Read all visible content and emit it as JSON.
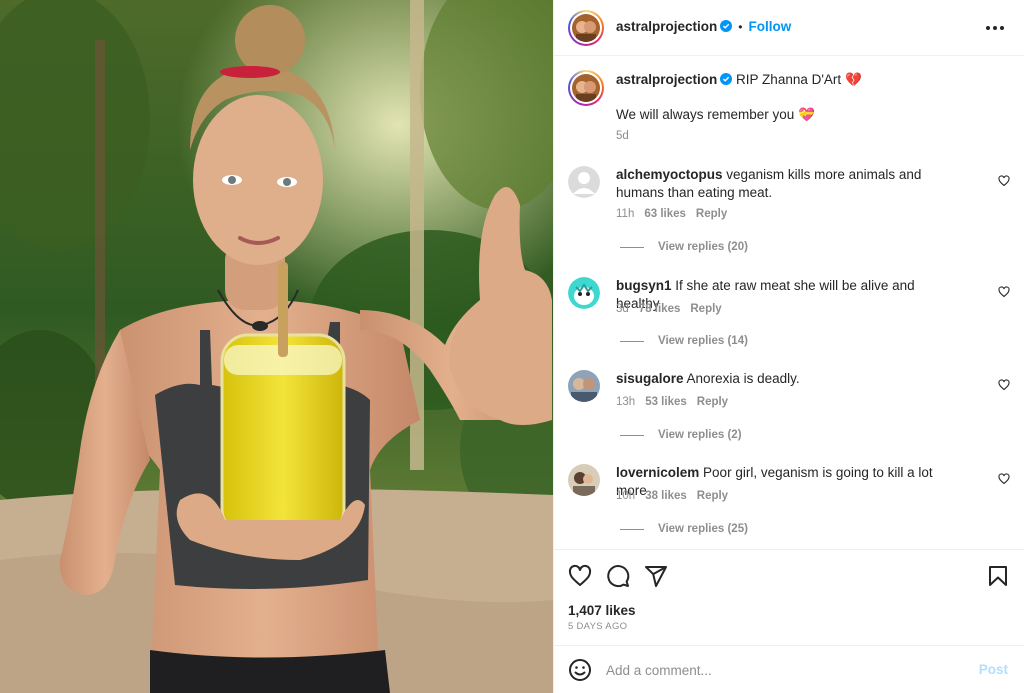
{
  "post": {
    "author": "astralprojection",
    "follow_label": "Follow",
    "header_separator": "•",
    "caption": {
      "line1": "RIP Zhanna D'Art",
      "line1_emoji": "💔",
      "line2": "We will always remember you",
      "line2_emoji": "💝",
      "time": "5d"
    },
    "photo_alt": "Woman holding a glass of yellow juice with a straw, giving a thumbs up in a jungle",
    "likes": "1,407 likes",
    "date": "5 DAYS AGO"
  },
  "comments": [
    {
      "user": "alchemyoctopus",
      "text": "veganism kills more animals and humans than eating meat.",
      "time": "11h",
      "likes": "63 likes",
      "reply_label": "Reply",
      "view_replies": "View replies (20)",
      "avatar": "default-avatar-icon"
    },
    {
      "user": "bugsyn1",
      "text": "If she ate raw meat she will be alive and healthy",
      "time": "3d",
      "likes": "78 likes",
      "reply_label": "Reply",
      "view_replies": "View replies (14)",
      "avatar": "cartoon-avatar"
    },
    {
      "user": "sisugalore",
      "text": "Anorexia is deadly.",
      "time": "13h",
      "likes": "53 likes",
      "reply_label": "Reply",
      "view_replies": "View replies (2)",
      "avatar": "photo-avatar"
    },
    {
      "user": "lovernicolem",
      "text": "Poor girl, veganism is going to kill a lot more",
      "time": "10h",
      "likes": "38 likes",
      "reply_label": "Reply",
      "view_replies": "View replies (25)",
      "avatar": "photo-avatar"
    }
  ],
  "add_comment": {
    "placeholder": "Add a comment...",
    "post_label": "Post"
  },
  "colors": {
    "link_blue": "#0095f6",
    "muted": "#8e8e8e",
    "post_disabled": "#b2dffc"
  }
}
